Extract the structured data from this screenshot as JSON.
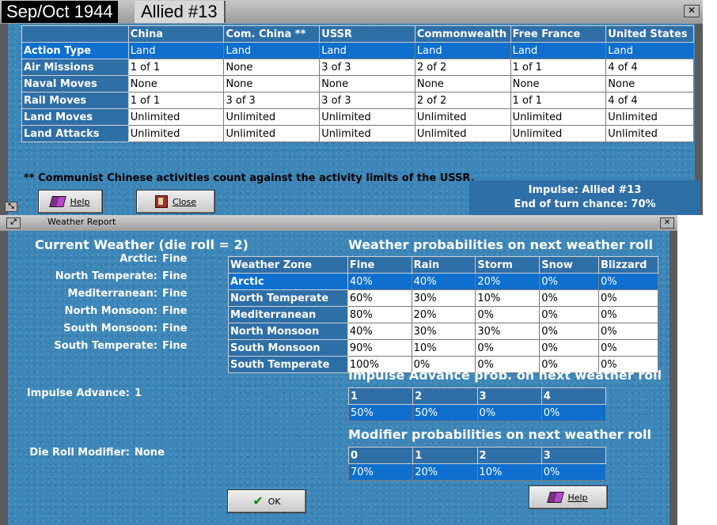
{
  "top_window": {
    "tab_date": "Sep/Oct 1944",
    "tab_impulse": "Allied #13",
    "columns": [
      "China",
      "Com. China **",
      "USSR",
      "Commonwealth",
      "Free France",
      "United States"
    ],
    "rows": [
      {
        "label": "Action Type",
        "values": [
          "Land",
          "Land",
          "Land",
          "Land",
          "Land",
          "Land"
        ],
        "selected": true
      },
      {
        "label": "Air Missions",
        "values": [
          "1 of 1",
          "None",
          "3 of 3",
          "2 of 2",
          "1 of 1",
          "4 of 4"
        ]
      },
      {
        "label": "Naval Moves",
        "values": [
          "None",
          "None",
          "None",
          "None",
          "None",
          "None"
        ]
      },
      {
        "label": "Rail Moves",
        "values": [
          "1 of 1",
          "3 of 3",
          "3 of 3",
          "2 of 2",
          "1 of 1",
          "4 of 4"
        ]
      },
      {
        "label": "Land Moves",
        "values": [
          "Unlimited",
          "Unlimited",
          "Unlimited",
          "Unlimited",
          "Unlimited",
          "Unlimited"
        ]
      },
      {
        "label": "Land Attacks",
        "values": [
          "Unlimited",
          "Unlimited",
          "Unlimited",
          "Unlimited",
          "Unlimited",
          "Unlimited"
        ]
      }
    ],
    "note": "** Communist Chinese activities count against the activity limits of the USSR.",
    "help_label": "Help",
    "close_label": "Close",
    "impulse_line": "Impulse: Allied #13",
    "end_chance_line": "End of turn chance: 70%"
  },
  "bottom_window": {
    "title": "Weather Report",
    "current_heading": "Current Weather (die roll = 2)",
    "zones_current": [
      {
        "zone": "Arctic:",
        "value": "Fine"
      },
      {
        "zone": "North Temperate:",
        "value": "Fine"
      },
      {
        "zone": "Mediterranean:",
        "value": "Fine"
      },
      {
        "zone": "North Monsoon:",
        "value": "Fine"
      },
      {
        "zone": "South Monsoon:",
        "value": "Fine"
      },
      {
        "zone": "South Temperate:",
        "value": "Fine"
      }
    ],
    "impulse_advance_label": "Impulse Advance:",
    "impulse_advance_value": "1",
    "die_roll_label": "Die Roll Modifier:",
    "die_roll_value": "None",
    "prob_heading": "Weather probabilities on next weather roll",
    "prob_columns": [
      "Weather Zone",
      "Fine",
      "Rain",
      "Storm",
      "Snow",
      "Blizzard"
    ],
    "prob_rows": [
      {
        "zone": "Arctic",
        "values": [
          "40%",
          "40%",
          "20%",
          "0%",
          "0%"
        ],
        "selected": true
      },
      {
        "zone": "North Temperate",
        "values": [
          "60%",
          "30%",
          "10%",
          "0%",
          "0%"
        ]
      },
      {
        "zone": "Mediterranean",
        "values": [
          "80%",
          "20%",
          "0%",
          "0%",
          "0%"
        ]
      },
      {
        "zone": "North Monsoon",
        "values": [
          "40%",
          "30%",
          "30%",
          "0%",
          "0%"
        ]
      },
      {
        "zone": "South Monsoon",
        "values": [
          "90%",
          "10%",
          "0%",
          "0%",
          "0%"
        ]
      },
      {
        "zone": "South Temperate",
        "values": [
          "100%",
          "0%",
          "0%",
          "0%",
          "0%"
        ]
      }
    ],
    "advance_heading": "Impulse Advance prob. on next weather roll",
    "advance_columns": [
      "1",
      "2",
      "3",
      "4"
    ],
    "advance_values": [
      "50%",
      "50%",
      "0%",
      "0%"
    ],
    "modifier_heading": "Modifier probabilities on next weather roll",
    "modifier_columns": [
      "0",
      "1",
      "2",
      "3"
    ],
    "modifier_values": [
      "70%",
      "20%",
      "10%",
      "0%"
    ],
    "ok_label": "OK",
    "help_label": "Help"
  },
  "colors": {
    "panel": "#3d86b8",
    "header_cell": "#2f6fa8",
    "selection": "#0e6fcf"
  }
}
